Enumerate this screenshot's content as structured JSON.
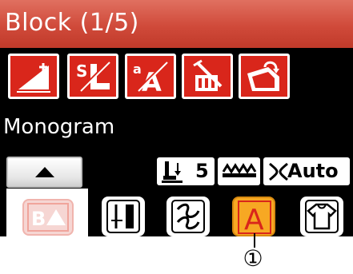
{
  "header": {
    "title": "Block (1/5)"
  },
  "toolbar": {
    "icons": [
      "enlarge-icon",
      "stitch-length-icon",
      "letter-size-icon",
      "delete-icon",
      "save-icon"
    ]
  },
  "section": {
    "label": "Monogram"
  },
  "controls": {
    "scroll_up": "up-arrow-icon",
    "presser_foot_value": "5",
    "auto_label": "Auto"
  },
  "tabs": {
    "items": [
      "block-letter-icon",
      "stitch-pattern-icon",
      "decorative-icon",
      "letter-a-icon",
      "garment-icon"
    ],
    "selected": "block-letter-icon",
    "highlighted": "letter-a-icon"
  },
  "annotation": {
    "callout_number": "①"
  },
  "colors": {
    "title_bar": "#d04a3a",
    "icon_red": "#d9261b",
    "highlight_orange": "#f7a823",
    "background": "#000000"
  }
}
